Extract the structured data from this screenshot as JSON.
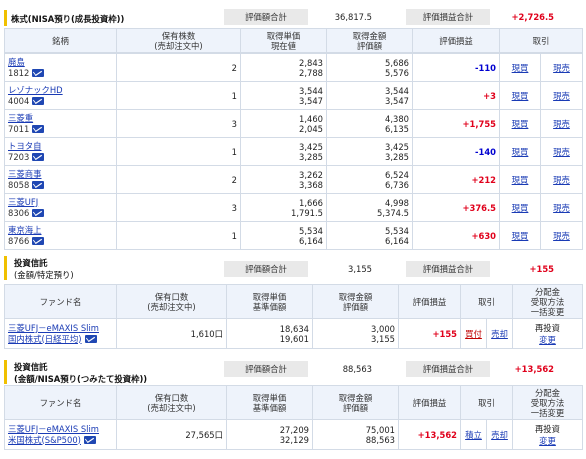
{
  "nisa_growth": {
    "title": "株式(NISA預り(成長投資枠))",
    "summary_label1": "評価額合計",
    "summary_value1": "36,817.5",
    "summary_label2": "評価損益合計",
    "summary_value2": "+2,726.5",
    "headers": [
      "銘柄",
      "保有株数\n(売却注文中)",
      "取得単価\n現在値",
      "取得金額\n評価額",
      "評価損益",
      "取引"
    ],
    "rows": [
      {
        "name": "廃島",
        "code": "1812",
        "qty": "2",
        "price1": "2,843",
        "price2": "2,788",
        "amt1": "5,686",
        "amt2": "5,576",
        "pl": "-110",
        "pl_sign": "neg",
        "buy": "現買",
        "sell": "現売"
      },
      {
        "name": "レゾナックHD",
        "code": "4004",
        "qty": "1",
        "price1": "3,544",
        "price2": "3,547",
        "amt1": "3,544",
        "amt2": "3,547",
        "pl": "+3",
        "pl_sign": "pos",
        "buy": "現買",
        "sell": "現売"
      },
      {
        "name": "三菱重",
        "code": "7011",
        "qty": "3",
        "price1": "1,460",
        "price2": "2,045",
        "amt1": "4,380",
        "amt2": "6,135",
        "pl": "+1,755",
        "pl_sign": "pos",
        "buy": "現買",
        "sell": "現売"
      },
      {
        "name": "トヨタ自",
        "code": "7203",
        "qty": "1",
        "price1": "3,425",
        "price2": "3,285",
        "amt1": "3,425",
        "amt2": "3,285",
        "pl": "-140",
        "pl_sign": "neg",
        "buy": "現買",
        "sell": "現売"
      },
      {
        "name": "三菱商事",
        "code": "8058",
        "qty": "2",
        "price1": "3,262",
        "price2": "3,368",
        "amt1": "6,524",
        "amt2": "6,736",
        "pl": "+212",
        "pl_sign": "pos",
        "buy": "現買",
        "sell": "現売"
      },
      {
        "name": "三菱UFJ",
        "code": "8306",
        "qty": "3",
        "price1": "1,666",
        "price2": "1,791.5",
        "amt1": "4,998",
        "amt2": "5,374.5",
        "pl": "+376.5",
        "pl_sign": "pos",
        "buy": "現買",
        "sell": "現売"
      },
      {
        "name": "東京海上",
        "code": "8766",
        "qty": "1",
        "price1": "5,534",
        "price2": "6,164",
        "amt1": "5,534",
        "amt2": "6,164",
        "pl": "+630",
        "pl_sign": "pos",
        "buy": "現買",
        "sell": "現売"
      }
    ]
  },
  "fund_specific": {
    "title1": "投資信託",
    "title2": "(金額/特定預り)",
    "summary_label1": "評価額合計",
    "summary_value1": "3,155",
    "summary_label2": "評価損益合計",
    "summary_value2": "+155",
    "headers": [
      "ファンド名",
      "保有口数\n(売却注文中)",
      "取得単価\n基準価額",
      "取得金額\n評価額",
      "評価損益",
      "取引",
      "分配金\n受取方法\n一括変更"
    ],
    "row": {
      "name1": "三菱UFJ－eMAXIS Slim",
      "name2": "国内株式(日経平均)",
      "units": "1,610口",
      "price1": "18,634",
      "price2": "19,601",
      "amt1": "3,000",
      "amt2": "3,155",
      "pl": "+155",
      "buy": "買付",
      "sell": "売却",
      "dist1": "再投資",
      "dist2": "変更"
    }
  },
  "fund_nisa": {
    "title1": "投資信託",
    "title2": "(金額/NISA預り(つみたて投資枠))",
    "summary_label1": "評価額合計",
    "summary_value1": "88,563",
    "summary_label2": "評価損益合計",
    "summary_value2": "+13,562",
    "headers": [
      "ファンド名",
      "保有口数\n(売却注文中)",
      "取得単価\n基準価額",
      "取得金額\n評価額",
      "評価損益",
      "取引",
      "分配金\n受取方法\n一括変更"
    ],
    "row": {
      "name1": "三菱UFJ－eMAXIS Slim",
      "name2": "米国株式(S&P500)",
      "units": "27,565口",
      "price1": "27,209",
      "price2": "32,129",
      "amt1": "75,001",
      "amt2": "88,563",
      "pl": "+13,562",
      "buy": "積立",
      "sell": "売却",
      "dist1": "再投資",
      "dist2": "変更"
    }
  }
}
